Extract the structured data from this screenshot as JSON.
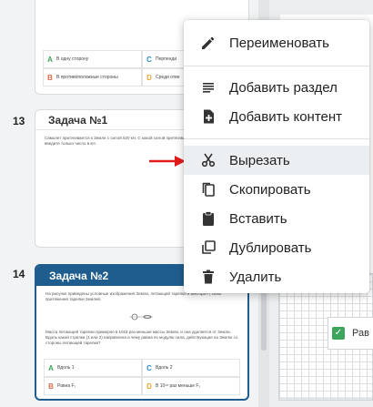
{
  "cards": [
    {
      "number": "",
      "title": "",
      "text": "",
      "options": [
        {
          "letter": "A",
          "text": "В одну сторону"
        },
        {
          "letter": "C",
          "text": "Перпенди"
        },
        {
          "letter": "B",
          "text": "В противоположные стороны"
        },
        {
          "letter": "D",
          "text": "Среди отве"
        }
      ]
    },
    {
      "number": "13",
      "title": "Задача №1",
      "text": "Самолет притягивается к Земле с силой 520 кН. С какой силой притягивается к самолету? В ответе введите только число в кН."
    },
    {
      "number": "14",
      "title": "Задача №2",
      "text": "На рисунке приведены условные изображения Земли, летающей тарелки и вектора F₁ силы притяжения тарелки Землей.",
      "text2": "Масса летающей тарелки примерно в 1018 раз меньше массы Земли, и она удаляется от Земли. Вдоль какой стрелки (1 или 2) направлена и чему равна по модулю сила, действующая на Землю со стороны летающей тарелки?",
      "options": [
        {
          "letter": "A",
          "text": "Вдоль 1"
        },
        {
          "letter": "C",
          "text": "Вдоль 2"
        },
        {
          "letter": "B",
          "text": "Равна F₁"
        },
        {
          "letter": "D",
          "text": "В 10¹⁸ раз меньше F₁"
        }
      ]
    }
  ],
  "context_menu": {
    "items": [
      {
        "icon": "pencil-icon",
        "label": "Переименовать"
      },
      {
        "icon": "add-section-icon",
        "label": "Добавить раздел"
      },
      {
        "icon": "add-content-icon",
        "label": "Добавить контент"
      },
      {
        "icon": "scissors-icon",
        "label": "Вырезать"
      },
      {
        "icon": "copy-icon",
        "label": "Скопировать"
      },
      {
        "icon": "clipboard-icon",
        "label": "Вставить"
      },
      {
        "icon": "duplicate-icon",
        "label": "Дублировать"
      },
      {
        "icon": "trash-icon",
        "label": "Удалить"
      }
    ]
  },
  "right_panel": {
    "answer_text": "Рав"
  },
  "colors": {
    "accent": "#1f5d8f",
    "arrow": "#e31b1b",
    "check": "#3aa55b"
  }
}
